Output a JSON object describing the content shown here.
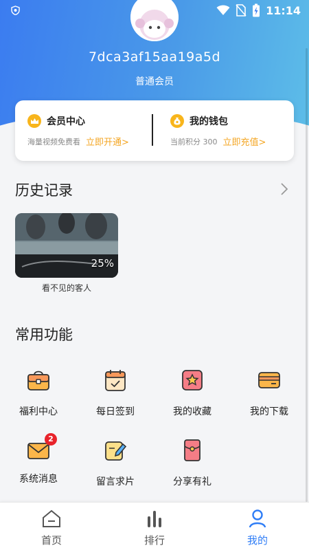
{
  "status_bar": {
    "time": "11:14"
  },
  "profile": {
    "username": "7dca3af15aa19a5d",
    "membership_level": "普通会员"
  },
  "vip_card": {
    "member_center": {
      "title": "会员中心",
      "subtitle": "海量视频免费看",
      "action": "立即开通>"
    },
    "wallet": {
      "title": "我的钱包",
      "subtitle": "当前积分 300",
      "action": "立即充值>"
    }
  },
  "history": {
    "title": "历史记录",
    "items": [
      {
        "name": "看不见的客人",
        "progress": "25%"
      }
    ]
  },
  "functions": {
    "title": "常用功能",
    "items": [
      {
        "label": "福利中心",
        "icon": "gift-box-icon"
      },
      {
        "label": "每日签到",
        "icon": "calendar-check-icon"
      },
      {
        "label": "我的收藏",
        "icon": "star-icon"
      },
      {
        "label": "我的下载",
        "icon": "card-download-icon"
      },
      {
        "label": "系统消息",
        "icon": "mail-icon",
        "badge": "2"
      },
      {
        "label": "留言求片",
        "icon": "edit-note-icon"
      },
      {
        "label": "分享有礼",
        "icon": "red-envelope-icon"
      }
    ]
  },
  "bottom_nav": {
    "items": [
      {
        "label": "首页",
        "icon": "home-icon"
      },
      {
        "label": "排行",
        "icon": "bar-chart-icon"
      },
      {
        "label": "我的",
        "icon": "user-icon",
        "active": true
      }
    ]
  },
  "colors": {
    "accent": "#2f7df6",
    "action_orange": "#f4a623",
    "badge_red": "#e8232b"
  }
}
